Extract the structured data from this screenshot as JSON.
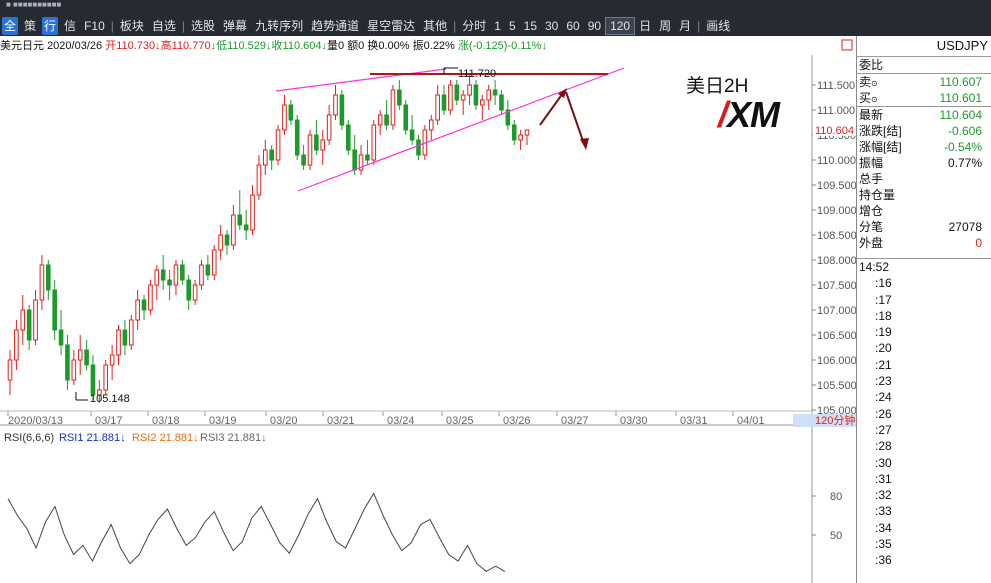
{
  "toolbar": {
    "items": [
      "全",
      "策",
      "行",
      "信",
      "F10",
      "板块",
      "自选",
      "选股",
      "弹幕",
      "九转序列",
      "趋势通道",
      "星空雷达",
      "其他",
      "分时",
      "1",
      "5",
      "15",
      "30",
      "60",
      "90",
      "120",
      "日",
      "周",
      "月",
      "画线"
    ],
    "selected": "120"
  },
  "info": {
    "name": "美元日元",
    "date": "2020/03/26",
    "open_label": "开",
    "open": "110.730",
    "high_label": "高",
    "high": "110.770",
    "low_label": "低",
    "low": "110.529",
    "close_label": "收",
    "close": "110.604",
    "vol": "量0",
    "amt": "额0",
    "turn": "换0.00%",
    "amp": "振0.22%",
    "chg": "涨(-0.125)-0.11%"
  },
  "watermark": {
    "title": "美日2H",
    "logo": "XM"
  },
  "price_axis": {
    "ticks": [
      "111.500",
      "111.000",
      "110.500",
      "110.000",
      "109.500",
      "109.000",
      "108.500",
      "108.000",
      "107.500",
      "107.000",
      "106.500",
      "106.000",
      "105.500",
      "105.000"
    ],
    "current": "110.604"
  },
  "annotations": {
    "high_label": "111.720",
    "low_label": "105.148"
  },
  "date_axis": {
    "labels": [
      "2020/03/13",
      "03/17",
      "03/18",
      "03/19",
      "03/20",
      "03/21",
      "03/24",
      "03/25",
      "03/26",
      "03/27",
      "03/30",
      "03/31",
      "04/01"
    ],
    "period": "120分钟"
  },
  "rsi": {
    "title": "RSI(6,6,6)",
    "r1": "RSI1 21.881↓",
    "r2": "RSI2 21.881↓",
    "r3": "RSI3 21.881↓",
    "ticks": [
      "80",
      "50"
    ]
  },
  "colors": {
    "up": "#e0201c",
    "down": "#1c9a2c",
    "trend": "#ff30d8",
    "arrow": "#7a0f10",
    "resist": "#b01818"
  },
  "quote": {
    "symbol": "USDJPY",
    "webi": "委比",
    "sell_label": "卖",
    "sell": "110.607",
    "buy_label": "买",
    "buy": "110.601",
    "last_label": "最新",
    "last": "110.604",
    "chg_label": "涨跌[结]",
    "chg": "-0.606",
    "pct_label": "涨幅[结]",
    "pct": "-0.54%",
    "amp_label": "振幅",
    "amp": "0.77%",
    "total_label": "总手",
    "oi_label": "持仓量",
    "inc_label": "增仓",
    "trades_label": "分笔",
    "trades": "27078",
    "outer_label": "外盘",
    "outer": "0"
  },
  "times": [
    "14:52",
    ":16",
    ":17",
    ":18",
    ":19",
    ":20",
    ":21",
    ":23",
    ":24",
    ":26",
    ":27",
    ":28",
    ":30",
    ":31",
    ":32",
    ":33",
    ":34",
    ":35",
    ":36"
  ],
  "chart_data": {
    "type": "candlestick",
    "symbol": "USDJPY",
    "timeframe": "120分钟",
    "ylim": [
      105.0,
      111.6
    ],
    "candles": [
      [
        105.6,
        106.2,
        105.3,
        106.0
      ],
      [
        106.0,
        106.8,
        105.8,
        106.6
      ],
      [
        106.6,
        107.3,
        106.3,
        107.0
      ],
      [
        107.0,
        107.1,
        106.2,
        106.4
      ],
      [
        106.4,
        107.4,
        106.3,
        107.2
      ],
      [
        107.2,
        108.1,
        107.0,
        107.9
      ],
      [
        107.9,
        108.0,
        107.2,
        107.4
      ],
      [
        107.4,
        107.6,
        106.4,
        106.6
      ],
      [
        106.6,
        107.0,
        106.1,
        106.3
      ],
      [
        106.3,
        106.5,
        105.4,
        105.6
      ],
      [
        105.6,
        106.2,
        105.5,
        106.0
      ],
      [
        106.0,
        106.5,
        105.7,
        106.2
      ],
      [
        106.2,
        106.4,
        105.8,
        105.9
      ],
      [
        105.9,
        106.1,
        105.2,
        105.3
      ],
      [
        105.3,
        105.6,
        105.148,
        105.4
      ],
      [
        105.4,
        106.0,
        105.3,
        105.9
      ],
      [
        105.9,
        106.3,
        105.6,
        106.1
      ],
      [
        106.1,
        106.7,
        105.9,
        106.6
      ],
      [
        106.6,
        106.8,
        106.1,
        106.3
      ],
      [
        106.3,
        106.9,
        106.2,
        106.8
      ],
      [
        106.8,
        107.4,
        106.6,
        107.2
      ],
      [
        107.2,
        107.3,
        106.8,
        107.0
      ],
      [
        107.0,
        107.6,
        106.9,
        107.5
      ],
      [
        107.5,
        107.9,
        107.2,
        107.8
      ],
      [
        107.8,
        108.1,
        107.4,
        107.6
      ],
      [
        107.6,
        107.8,
        107.2,
        107.5
      ],
      [
        107.5,
        108.0,
        107.3,
        107.9
      ],
      [
        107.9,
        108.0,
        107.5,
        107.6
      ],
      [
        107.6,
        107.7,
        107.0,
        107.2
      ],
      [
        107.2,
        107.6,
        107.1,
        107.5
      ],
      [
        107.5,
        108.0,
        107.4,
        107.9
      ],
      [
        107.9,
        108.1,
        107.6,
        107.7
      ],
      [
        107.7,
        108.3,
        107.6,
        108.2
      ],
      [
        108.2,
        108.7,
        108.0,
        108.5
      ],
      [
        108.5,
        108.6,
        108.1,
        108.3
      ],
      [
        108.3,
        109.1,
        108.2,
        108.9
      ],
      [
        108.9,
        109.4,
        108.6,
        108.7
      ],
      [
        108.7,
        109.0,
        108.4,
        108.6
      ],
      [
        108.6,
        109.5,
        108.5,
        109.3
      ],
      [
        109.3,
        110.1,
        109.2,
        109.9
      ],
      [
        109.9,
        110.4,
        109.7,
        110.2
      ],
      [
        110.2,
        110.3,
        109.8,
        110.0
      ],
      [
        110.0,
        110.7,
        109.9,
        110.6
      ],
      [
        110.6,
        111.3,
        110.5,
        111.1
      ],
      [
        111.1,
        111.2,
        110.7,
        110.8
      ],
      [
        110.8,
        110.9,
        110.0,
        110.1
      ],
      [
        110.1,
        110.3,
        109.8,
        109.9
      ],
      [
        109.9,
        110.6,
        109.8,
        110.5
      ],
      [
        110.5,
        110.8,
        110.1,
        110.2
      ],
      [
        110.2,
        110.6,
        109.9,
        110.4
      ],
      [
        110.4,
        111.1,
        110.3,
        110.9
      ],
      [
        110.9,
        111.5,
        110.8,
        111.3
      ],
      [
        111.3,
        111.4,
        110.6,
        110.7
      ],
      [
        110.7,
        110.8,
        110.1,
        110.2
      ],
      [
        110.2,
        110.5,
        109.7,
        109.8
      ],
      [
        109.8,
        110.3,
        109.7,
        110.1
      ],
      [
        110.1,
        110.4,
        109.9,
        110.0
      ],
      [
        110.0,
        110.8,
        109.9,
        110.7
      ],
      [
        110.7,
        111.0,
        110.5,
        110.9
      ],
      [
        110.9,
        111.2,
        110.6,
        110.7
      ],
      [
        110.7,
        111.5,
        110.6,
        111.4
      ],
      [
        111.4,
        111.6,
        111.0,
        111.1
      ],
      [
        111.1,
        111.2,
        110.5,
        110.6
      ],
      [
        110.6,
        110.9,
        110.3,
        110.4
      ],
      [
        110.4,
        110.5,
        110.0,
        110.1
      ],
      [
        110.1,
        110.7,
        110.0,
        110.6
      ],
      [
        110.6,
        110.9,
        110.4,
        110.8
      ],
      [
        110.8,
        111.5,
        110.7,
        111.3
      ],
      [
        111.3,
        111.5,
        110.9,
        111.0
      ],
      [
        111.0,
        111.6,
        110.9,
        111.5
      ],
      [
        111.5,
        111.6,
        111.1,
        111.2
      ],
      [
        111.2,
        111.4,
        110.9,
        111.3
      ],
      [
        111.3,
        111.7,
        111.1,
        111.5
      ],
      [
        111.5,
        111.6,
        111.0,
        111.1
      ],
      [
        111.1,
        111.3,
        110.8,
        111.2
      ],
      [
        111.2,
        111.5,
        111.0,
        111.4
      ],
      [
        111.4,
        111.6,
        111.1,
        111.3
      ],
      [
        111.3,
        111.4,
        110.9,
        111.0
      ],
      [
        111.0,
        111.2,
        110.6,
        110.7
      ],
      [
        110.7,
        110.8,
        110.3,
        110.4
      ],
      [
        110.4,
        110.6,
        110.2,
        110.5
      ],
      [
        110.5,
        110.6,
        110.3,
        110.6
      ]
    ],
    "rsi": [
      78,
      65,
      55,
      40,
      60,
      72,
      50,
      35,
      42,
      30,
      45,
      58,
      40,
      28,
      35,
      50,
      62,
      70,
      55,
      42,
      48,
      60,
      68,
      52,
      38,
      45,
      63,
      72,
      58,
      44,
      36,
      50,
      66,
      78,
      60,
      45,
      40,
      55,
      70,
      82,
      65,
      50,
      38,
      44,
      58,
      62,
      48,
      35,
      30,
      42,
      28,
      22,
      26,
      21.881
    ]
  }
}
